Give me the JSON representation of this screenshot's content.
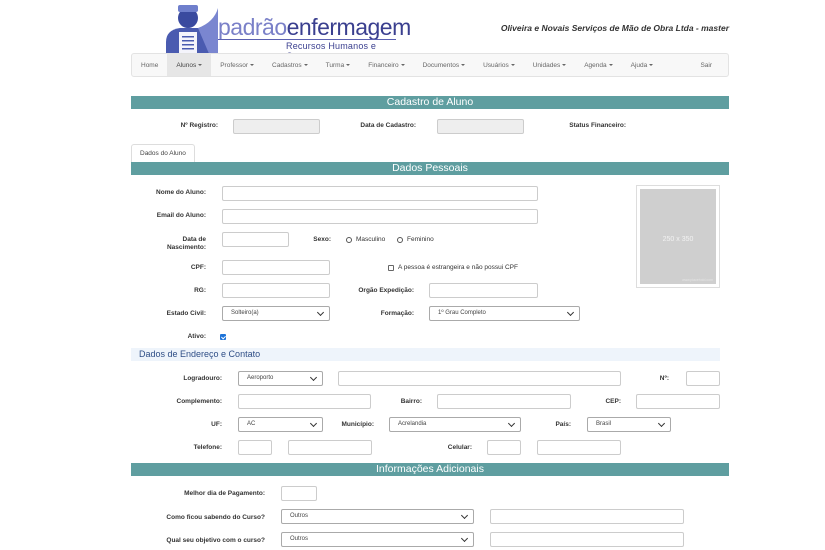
{
  "header": {
    "brand_part1": "padrão",
    "brand_part2": "enfermagem",
    "tagline": "Recursos Humanos e Cursos",
    "company": "Oliveira e Novais Serviços de Mão de Obra Ltda - master"
  },
  "nav": [
    {
      "label": "Home",
      "dropdown": false,
      "active": false
    },
    {
      "label": "Alunos",
      "dropdown": true,
      "active": true
    },
    {
      "label": "Professor",
      "dropdown": true,
      "active": false
    },
    {
      "label": "Cadastros",
      "dropdown": true,
      "active": false
    },
    {
      "label": "Turma",
      "dropdown": true,
      "active": false
    },
    {
      "label": "Financeiro",
      "dropdown": true,
      "active": false
    },
    {
      "label": "Documentos",
      "dropdown": true,
      "active": false
    },
    {
      "label": "Usuários",
      "dropdown": true,
      "active": false
    },
    {
      "label": "Unidades",
      "dropdown": true,
      "active": false
    },
    {
      "label": "Agenda",
      "dropdown": true,
      "active": false
    },
    {
      "label": "Ajuda",
      "dropdown": true,
      "active": false
    },
    {
      "label": "Sair",
      "dropdown": false,
      "active": false
    }
  ],
  "cadastro": {
    "title": "Cadastro de Aluno",
    "registro_label": "Nº Registro:",
    "data_cadastro_label": "Data de Cadastro:",
    "status_financeiro_label": "Status Financeiro:"
  },
  "tab_label": "Dados do Aluno",
  "dados_pessoais": {
    "title": "Dados Pessoais",
    "nome_label": "Nome do Aluno:",
    "email_label": "Email do Aluno:",
    "nascimento_label": "Data de Nascimento:",
    "sexo_label": "Sexo:",
    "masculino": "Masculino",
    "feminino": "Feminino",
    "cpf_label": "CPF:",
    "estrangeira_label": "A pessoa é estrangeira e não possui CPF",
    "rg_label": "RG:",
    "orgao_label": "Orgão Expedição:",
    "estado_civil_label": "Estado Civil:",
    "estado_civil_value": "Solteiro(a)",
    "formacao_label": "Formação:",
    "formacao_value": "1º Grau Completo",
    "ativo_label": "Ativo:",
    "ativo_checked": true,
    "photo_size": "250 x 350",
    "photo_credit": "www.placehold.com"
  },
  "endereco": {
    "title": "Dados de Endereço e Contato",
    "logradouro_label": "Logradouro:",
    "logradouro_value": "Aeroporto",
    "numero_label": "Nº:",
    "complemento_label": "Complemento:",
    "bairro_label": "Bairro:",
    "cep_label": "CEP:",
    "uf_label": "UF:",
    "uf_value": "AC",
    "municipio_label": "Município:",
    "municipio_value": "Acrelandia",
    "pais_label": "País:",
    "pais_value": "Brasil",
    "telefone_label": "Telefone:",
    "celular_label": "Celular:"
  },
  "adicionais": {
    "title": "Informações Adicionais",
    "pagamento_label": "Melhor dia de Pagamento:",
    "curso_label": "Como ficou sabendo do Curso?",
    "curso_value": "Outros",
    "objetivo_label": "Qual seu objetivo com o curso?",
    "objetivo_value": "Outros"
  }
}
